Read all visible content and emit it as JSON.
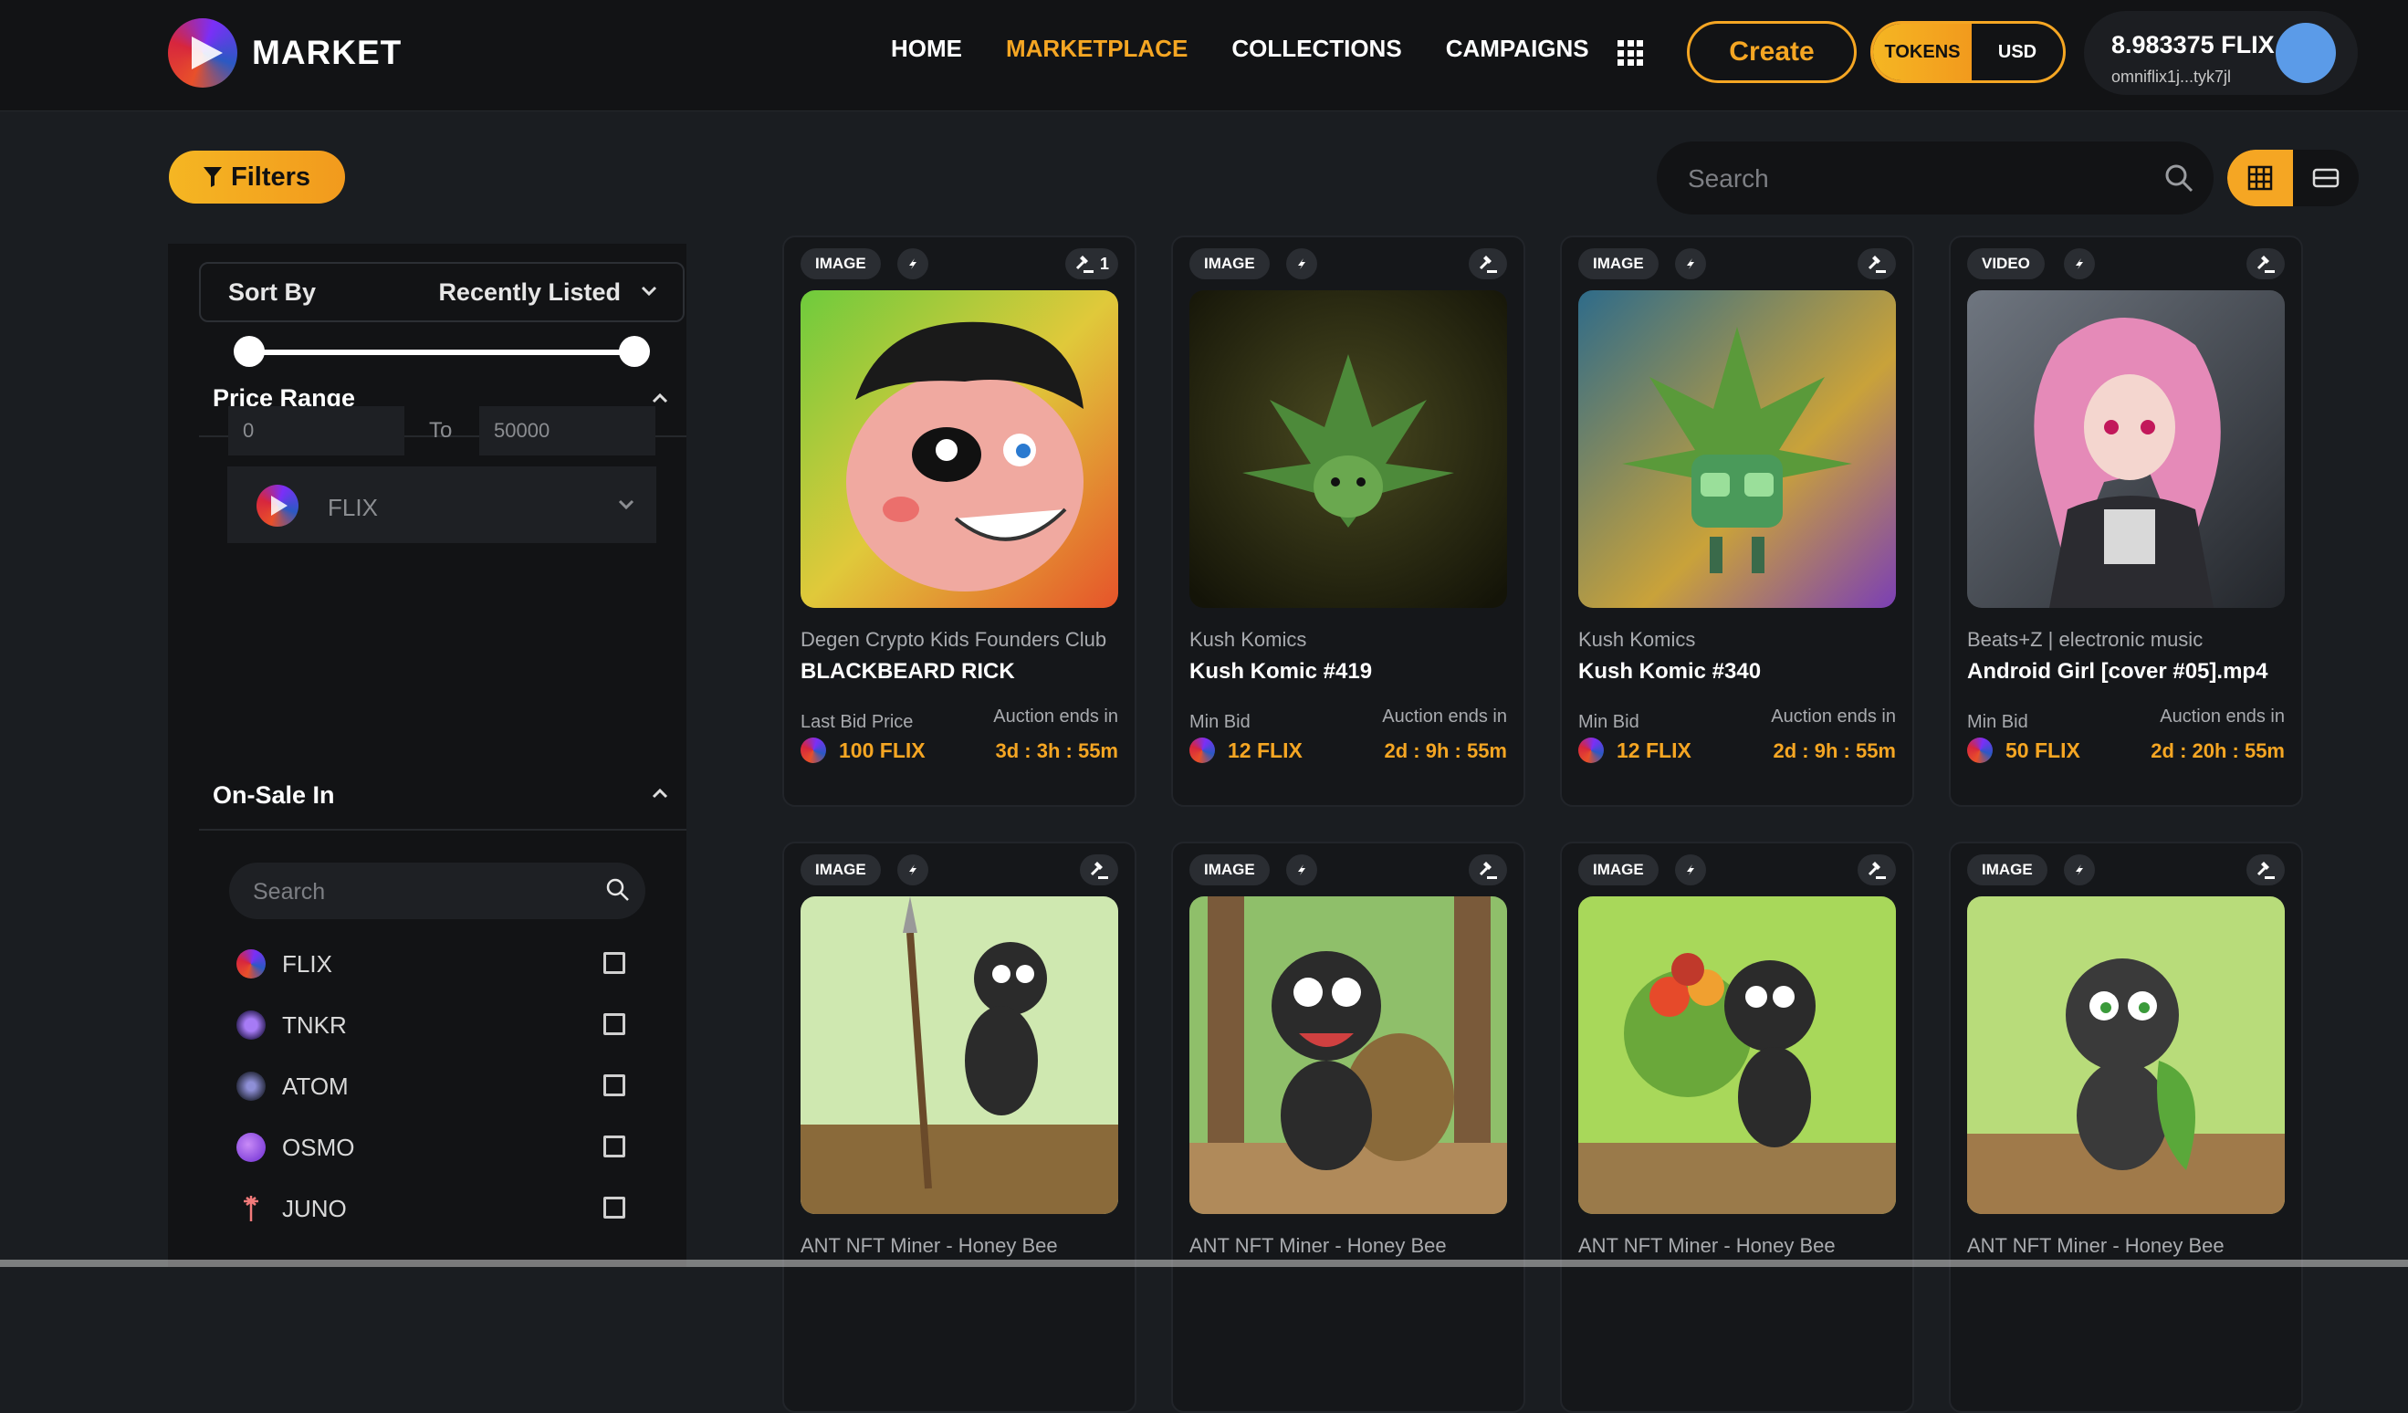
{
  "header": {
    "logo_text": "MARKET",
    "nav": [
      "HOME",
      "MARKETPLACE",
      "COLLECTIONS",
      "CAMPAIGNS"
    ],
    "active_nav": "MARKETPLACE",
    "create_label": "Create",
    "currency_tokens": "TOKENS",
    "currency_usd": "USD",
    "wallet_balance": "8.983375 FLIX",
    "wallet_address": "omniflix1j...tyk7jl"
  },
  "toolbar": {
    "filters_label": "Filters",
    "search_placeholder": "Search"
  },
  "sidebar": {
    "sort_label": "Sort By",
    "sort_value": "Recently Listed",
    "price_range_title": "Price Range",
    "price_token": "FLIX",
    "range_from": "0",
    "range_to_label": "To",
    "range_to": "50000",
    "on_sale_title": "On-Sale In",
    "on_sale_search_placeholder": "Search",
    "tokens": [
      "FLIX",
      "TNKR",
      "ATOM",
      "OSMO",
      "JUNO"
    ]
  },
  "cards": [
    {
      "type": "IMAGE",
      "bid_count": "1",
      "collection": "Degen Crypto Kids Founders Club",
      "name": "BLACKBEARD RICK",
      "price_label": "Last Bid Price",
      "price": "100 FLIX",
      "ends_label": "Auction ends in",
      "ends": "3d : 3h : 55m"
    },
    {
      "type": "IMAGE",
      "bid_count": "",
      "collection": "Kush Komics",
      "name": "Kush Komic #419",
      "price_label": "Min Bid",
      "price": "12 FLIX",
      "ends_label": "Auction ends in",
      "ends": "2d : 9h : 55m"
    },
    {
      "type": "IMAGE",
      "bid_count": "",
      "collection": "Kush Komics",
      "name": "Kush Komic #340",
      "price_label": "Min Bid",
      "price": "12 FLIX",
      "ends_label": "Auction ends in",
      "ends": "2d : 9h : 55m"
    },
    {
      "type": "VIDEO",
      "bid_count": "",
      "collection": "Beats+Z | electronic music",
      "name": "Android Girl [cover #05].mp4",
      "price_label": "Min Bid",
      "price": "50 FLIX",
      "ends_label": "Auction ends in",
      "ends": "2d : 20h : 55m"
    },
    {
      "type": "IMAGE",
      "bid_count": "",
      "collection": "ANT NFT Miner - Honey Bee",
      "name": "",
      "price_label": "",
      "price": "",
      "ends_label": "",
      "ends": ""
    },
    {
      "type": "IMAGE",
      "bid_count": "",
      "collection": "ANT NFT Miner - Honey Bee",
      "name": "",
      "price_label": "",
      "price": "",
      "ends_label": "",
      "ends": ""
    },
    {
      "type": "IMAGE",
      "bid_count": "",
      "collection": "ANT NFT Miner - Honey Bee",
      "name": "",
      "price_label": "",
      "price": "",
      "ends_label": "",
      "ends": ""
    },
    {
      "type": "IMAGE",
      "bid_count": "",
      "collection": "ANT NFT Miner - Honey Bee",
      "name": "",
      "price_label": "",
      "price": "",
      "ends_label": "",
      "ends": ""
    }
  ],
  "colors": {
    "accent": "#f5a623",
    "background": "#1a1d21",
    "panel": "#121315"
  },
  "icons": [
    "logo-icon",
    "apps-grid-icon",
    "filter-icon",
    "search-icon",
    "grid-view-icon",
    "list-view-icon",
    "chevron-down-icon",
    "chevron-up-icon",
    "gavel-icon",
    "checkbox-icon"
  ]
}
